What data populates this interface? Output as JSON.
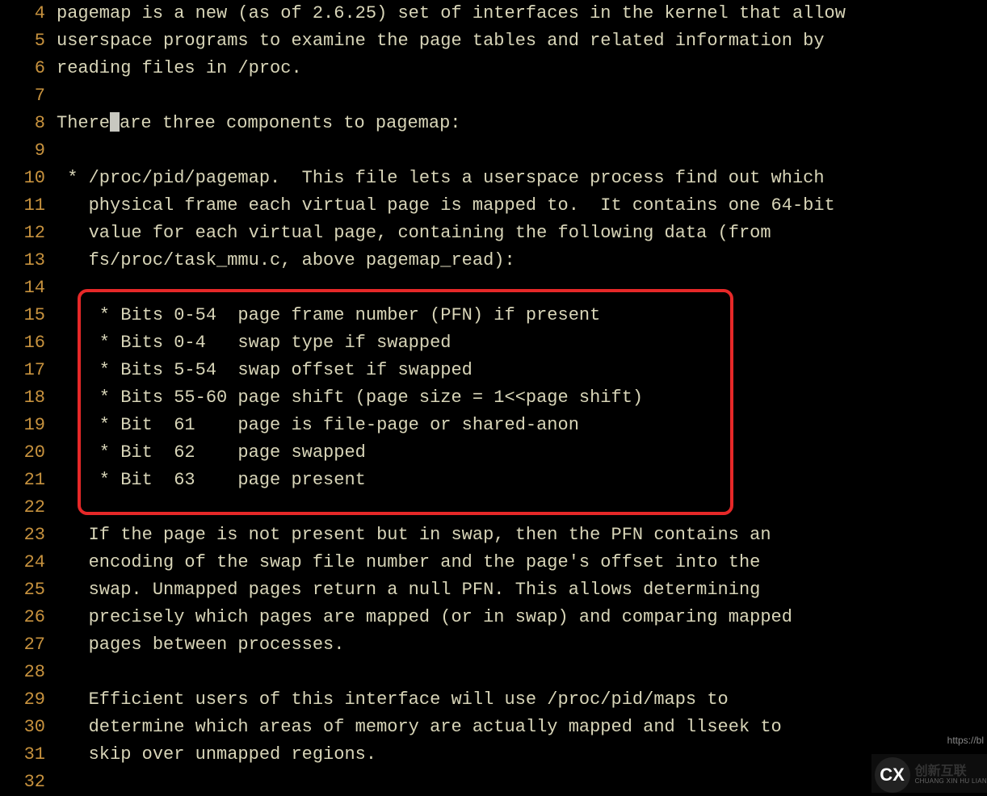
{
  "lines": [
    {
      "num": "4",
      "text": "pagemap is a new (as of 2.6.25) set of interfaces in the kernel that allow",
      "cursor": false
    },
    {
      "num": "5",
      "text": "userspace programs to examine the page tables and related information by",
      "cursor": false
    },
    {
      "num": "6",
      "text": "reading files in /proc.",
      "cursor": false
    },
    {
      "num": "7",
      "text": "",
      "cursor": false
    },
    {
      "num": "8",
      "text_pre": "There",
      "text_post": "are three components to pagemap:",
      "cursor": true
    },
    {
      "num": "9",
      "text": "",
      "cursor": false
    },
    {
      "num": "10",
      "text": " * /proc/pid/pagemap.  This file lets a userspace process find out which",
      "cursor": false
    },
    {
      "num": "11",
      "text": "   physical frame each virtual page is mapped to.  It contains one 64-bit",
      "cursor": false
    },
    {
      "num": "12",
      "text": "   value for each virtual page, containing the following data (from",
      "cursor": false
    },
    {
      "num": "13",
      "text": "   fs/proc/task_mmu.c, above pagemap_read):",
      "cursor": false
    },
    {
      "num": "14",
      "text": "",
      "cursor": false
    },
    {
      "num": "15",
      "text": "    * Bits 0-54  page frame number (PFN) if present",
      "cursor": false
    },
    {
      "num": "16",
      "text": "    * Bits 0-4   swap type if swapped",
      "cursor": false
    },
    {
      "num": "17",
      "text": "    * Bits 5-54  swap offset if swapped",
      "cursor": false
    },
    {
      "num": "18",
      "text": "    * Bits 55-60 page shift (page size = 1<<page shift)",
      "cursor": false
    },
    {
      "num": "19",
      "text": "    * Bit  61    page is file-page or shared-anon",
      "cursor": false
    },
    {
      "num": "20",
      "text": "    * Bit  62    page swapped",
      "cursor": false
    },
    {
      "num": "21",
      "text": "    * Bit  63    page present",
      "cursor": false
    },
    {
      "num": "22",
      "text": "",
      "cursor": false
    },
    {
      "num": "23",
      "text": "   If the page is not present but in swap, then the PFN contains an",
      "cursor": false
    },
    {
      "num": "24",
      "text": "   encoding of the swap file number and the page's offset into the",
      "cursor": false
    },
    {
      "num": "25",
      "text": "   swap. Unmapped pages return a null PFN. This allows determining",
      "cursor": false
    },
    {
      "num": "26",
      "text": "   precisely which pages are mapped (or in swap) and comparing mapped",
      "cursor": false
    },
    {
      "num": "27",
      "text": "   pages between processes.",
      "cursor": false
    },
    {
      "num": "28",
      "text": "",
      "cursor": false
    },
    {
      "num": "29",
      "text": "   Efficient users of this interface will use /proc/pid/maps to",
      "cursor": false
    },
    {
      "num": "30",
      "text": "   determine which areas of memory are actually mapped and llseek to",
      "cursor": false
    },
    {
      "num": "31",
      "text": "   skip over unmapped regions.",
      "cursor": false
    },
    {
      "num": "32",
      "text": "",
      "cursor": false
    }
  ],
  "watermark": {
    "icon_text": "CX",
    "cn": "创新互联",
    "en": "CHUANG XIN HU LIAN",
    "url": "https://bl"
  }
}
